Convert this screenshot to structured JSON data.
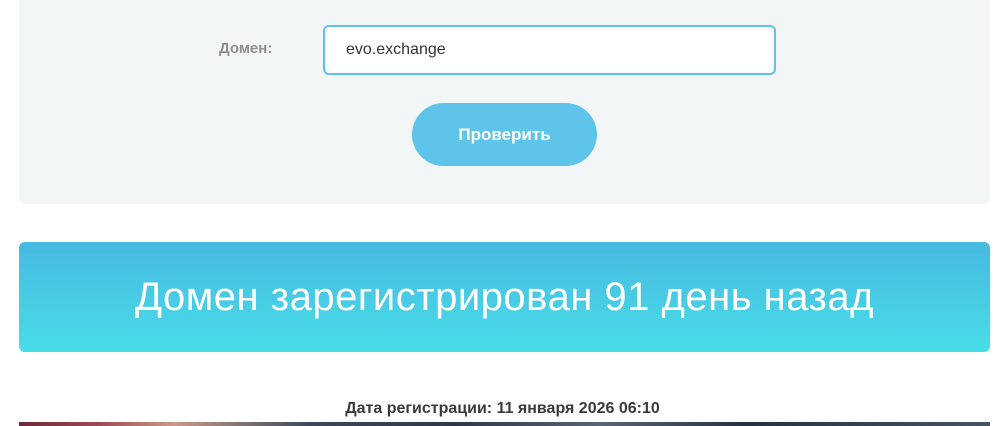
{
  "form": {
    "domain_label": "Домен:",
    "domain_value": "evo.exchange",
    "check_button_label": "Проверить"
  },
  "result": {
    "headline": "Домен зарегистрирован 91 день назад"
  },
  "registration": {
    "date_text": "Дата регистрации: 11 января 2026 06:10"
  },
  "colors": {
    "accent": "#5ec4ea",
    "banner_top": "#47b9e2",
    "banner_bottom": "#48dde6",
    "panel_bg": "#f3f6f7"
  }
}
